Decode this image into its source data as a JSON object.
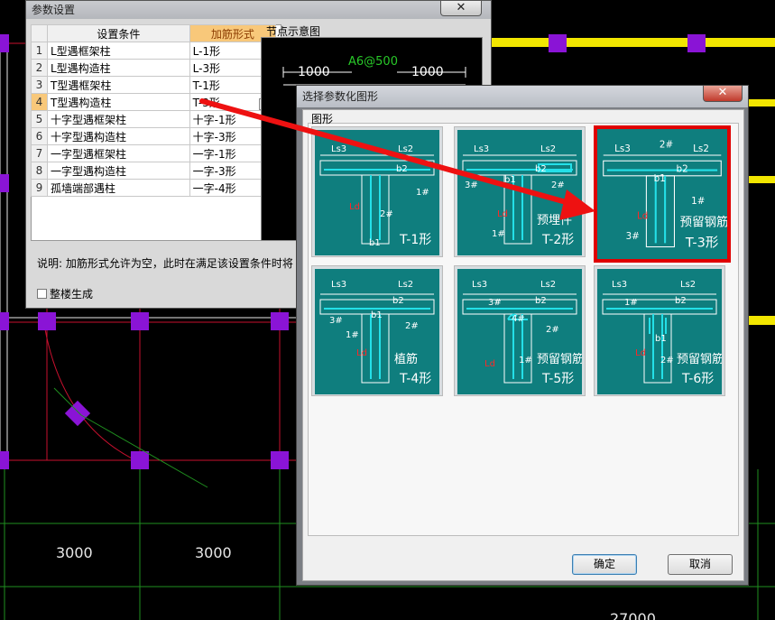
{
  "cad": {
    "dimensions": [
      "3000",
      "3000"
    ],
    "bottom_label": "27000"
  },
  "param_window": {
    "title": "参数设置",
    "close_glyph": "✕",
    "columns": [
      "设置条件",
      "加筋形式"
    ],
    "rows": [
      {
        "num": "1",
        "condition": "L型遇框架柱",
        "form": "L-1形"
      },
      {
        "num": "2",
        "condition": "L型遇构造柱",
        "form": "L-3形"
      },
      {
        "num": "3",
        "condition": "T型遇框架柱",
        "form": "T-1形"
      },
      {
        "num": "4",
        "condition": "T型遇构造柱",
        "form": "T-3形"
      },
      {
        "num": "5",
        "condition": "十字型遇框架柱",
        "form": "十字-1形"
      },
      {
        "num": "6",
        "condition": "十字型遇构造柱",
        "form": "十字-3形"
      },
      {
        "num": "7",
        "condition": "一字型遇框架柱",
        "form": "一字-1形"
      },
      {
        "num": "8",
        "condition": "一字型遇构造柱",
        "form": "一字-3形"
      },
      {
        "num": "9",
        "condition": "孤墙端部遇柱",
        "form": "一字-4形"
      }
    ],
    "selected_row": 4,
    "more_button": "...",
    "note": "说明: 加筋形式允许为空，此时在满足该设置条件时将",
    "whole_floor_label": "整楼生成",
    "node_title": "节点示意图",
    "node_preview": {
      "dim_left": "1000",
      "dim_right": "1000",
      "rebar": "A6@500"
    }
  },
  "select_dialog": {
    "title": "选择参数化图形",
    "close_glyph": "✕",
    "group_label": "图形",
    "ok_label": "确定",
    "cancel_label": "取消",
    "shapes": [
      {
        "name": "T-1形",
        "note": "",
        "labels": [
          "Ls3",
          "Ls2",
          "b2",
          "1#",
          "2#",
          "b1",
          "Ld"
        ]
      },
      {
        "name": "T-2形",
        "note": "预埋件",
        "labels": [
          "Ls3",
          "Ls2",
          "b2",
          "3#",
          "b1",
          "2#",
          "1#",
          "Ld"
        ]
      },
      {
        "name": "T-3形",
        "note": "预留钢筋",
        "labels": [
          "Ls3",
          "2#",
          "Ls2",
          "b2",
          "b1",
          "1#",
          "3#",
          "Ld"
        ]
      },
      {
        "name": "T-4形",
        "note": "植筋",
        "labels": [
          "Ls3",
          "Ls2",
          "b2",
          "b1",
          "3#",
          "2#",
          "1#",
          "Ld"
        ]
      },
      {
        "name": "T-5形",
        "note": "预留钢筋",
        "labels": [
          "Ls3",
          "Ls2",
          "3#",
          "b2",
          "4#",
          "2#",
          "1#",
          "Ld"
        ]
      },
      {
        "name": "T-6形",
        "note": "预留钢筋",
        "labels": [
          "Ls3",
          "Ls2",
          "1#",
          "b2",
          "b1",
          "2#",
          "Ld"
        ]
      }
    ],
    "selected_shape": 3
  },
  "colors": {
    "accent_red": "#e00000",
    "thumb_bg": "#0f7e7e",
    "rebar": "#24e0e8"
  }
}
